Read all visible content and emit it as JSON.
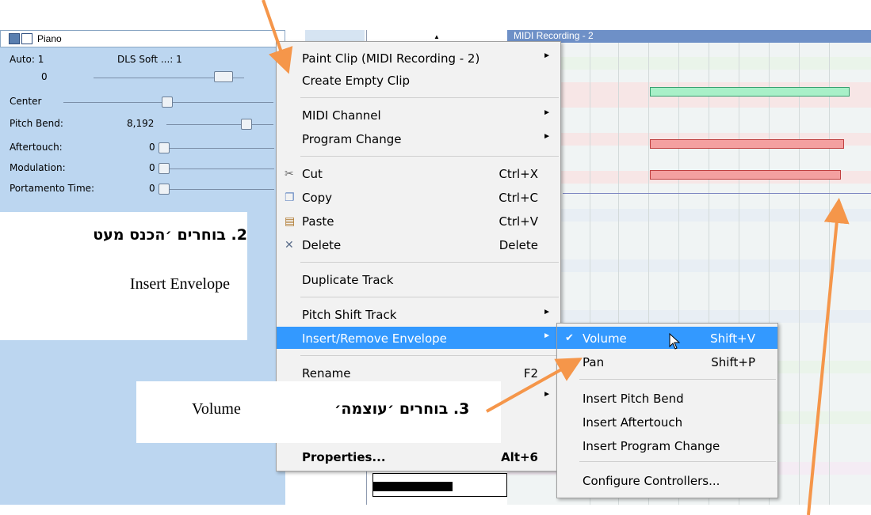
{
  "track": {
    "name": "Piano",
    "auto": "Auto: 1",
    "device": "DLS Soft ...: 1",
    "volume_value": "0",
    "pan_label": "Center",
    "pitch_bend_label": "Pitch Bend:",
    "pitch_bend_value": "8,192",
    "aftertouch_label": "Aftertouch:",
    "aftertouch_value": "0",
    "modulation_label": "Modulation:",
    "modulation_value": "0",
    "portamento_label": "Portamento Time:",
    "portamento_value": "0"
  },
  "roll": {
    "title": "MIDI Recording - 2"
  },
  "menu": {
    "items": [
      {
        "label": "Paint Clip (MIDI Recording - 2)",
        "submenu": true
      },
      {
        "label": "Create Empty Clip"
      },
      {
        "label": "MIDI Channel",
        "submenu": true
      },
      {
        "label": "Program Change",
        "submenu": true
      },
      {
        "label": "Cut",
        "shortcut": "Ctrl+X"
      },
      {
        "label": "Copy",
        "shortcut": "Ctrl+C"
      },
      {
        "label": "Paste",
        "shortcut": "Ctrl+V"
      },
      {
        "label": "Delete",
        "shortcut": "Delete"
      },
      {
        "label": "Duplicate Track"
      },
      {
        "label": "Pitch Shift Track",
        "submenu": true
      },
      {
        "label": "Insert/Remove Envelope",
        "submenu": true,
        "highlighted": true
      },
      {
        "label": "Rename",
        "shortcut": "F2"
      },
      {
        "label": "Properties...",
        "shortcut": "Alt+6"
      }
    ]
  },
  "submenu": {
    "items": [
      {
        "label": "Volume",
        "shortcut": "Shift+V",
        "checked": true,
        "highlighted": true
      },
      {
        "label": "Pan",
        "shortcut": "Shift+P"
      },
      {
        "label": "Insert Pitch Bend"
      },
      {
        "label": "Insert Aftertouch"
      },
      {
        "label": "Insert Program Change"
      },
      {
        "label": "Configure Controllers..."
      }
    ]
  },
  "annotations": {
    "step2_hebrew": "2. בוחרים ׳הכנס מעט",
    "step2_english": "Insert Envelope",
    "step3_hebrew": "3. בוחרים ׳עוצמה׳",
    "step3_english": "Volume"
  },
  "colors": {
    "highlight": "#3399ff",
    "arrow": "#f5964a",
    "panel": "#bcd6f0",
    "note_red": "#f4a0a0",
    "note_green": "#a8f0c8"
  }
}
